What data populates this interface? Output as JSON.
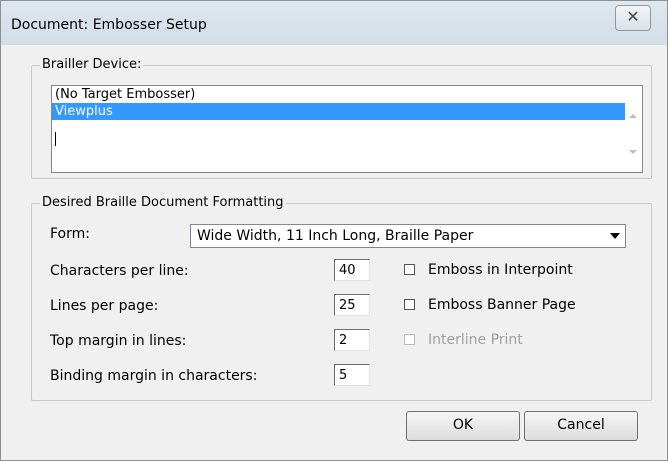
{
  "window": {
    "title": "Document: Embosser Setup",
    "close_glyph": "✕"
  },
  "device": {
    "group_label": "Brailler Device:",
    "items": [
      "(No Target Embosser)",
      "Viewplus"
    ],
    "selected_index": 1
  },
  "format": {
    "group_label": "Desired Braille Document Formatting",
    "form_label": "Form:",
    "form_value": "Wide Width, 11 Inch Long, Braille Paper",
    "fields": [
      {
        "label": "Characters per line:",
        "value": "40"
      },
      {
        "label": "Lines per page:",
        "value": "25"
      },
      {
        "label": "Top margin in lines:",
        "value": "2"
      },
      {
        "label": "Binding margin in characters:",
        "value": "5"
      }
    ],
    "checks": [
      {
        "label": "Emboss in Interpoint",
        "checked": false,
        "enabled": true
      },
      {
        "label": "Emboss Banner Page",
        "checked": false,
        "enabled": true
      },
      {
        "label": "Interline Print",
        "checked": false,
        "enabled": false
      }
    ]
  },
  "buttons": {
    "ok": "OK",
    "cancel": "Cancel"
  }
}
